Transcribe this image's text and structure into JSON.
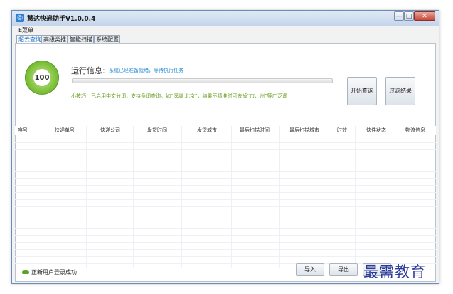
{
  "window": {
    "title": "慧达快递助手V1.0.0.4",
    "app_icon_glyph": "◎"
  },
  "window_controls": {
    "minimize": "—",
    "maximize": "□",
    "close": "✕"
  },
  "menu": {
    "label": "E菜单"
  },
  "tabs": [
    {
      "label": "超云查询",
      "active": true
    },
    {
      "label": "高级类推",
      "active": false
    },
    {
      "label": "智能扫描",
      "active": false
    },
    {
      "label": "系统配置",
      "active": false
    }
  ],
  "gauge": {
    "value": "100"
  },
  "status": {
    "label": "运行信息:",
    "message": "系统已经准备就绪，等待执行任务",
    "progress": 0
  },
  "tip": "小技巧：已启用中文分词，支持多词查询。如“深圳 北京”，结果不精准时可去掉“市、州”等广泛词",
  "buttons": {
    "start_query": "开始查询",
    "filter_results": "过滤结果",
    "import": "导入",
    "export": "导出"
  },
  "table": {
    "columns": [
      "序号",
      "快递单号",
      "快递公司",
      "发货时间",
      "发货城市",
      "最后扫描时间",
      "最后扫描城市",
      "时效",
      "快件状态",
      "物流信息"
    ],
    "rows": []
  },
  "footer": {
    "login_status": "正新用户登录成功"
  },
  "watermark": "最需教育",
  "colors": {
    "accent": "#2a8fd6",
    "gauge_green": "#7fc23a",
    "tip_green": "#6a9c20"
  }
}
